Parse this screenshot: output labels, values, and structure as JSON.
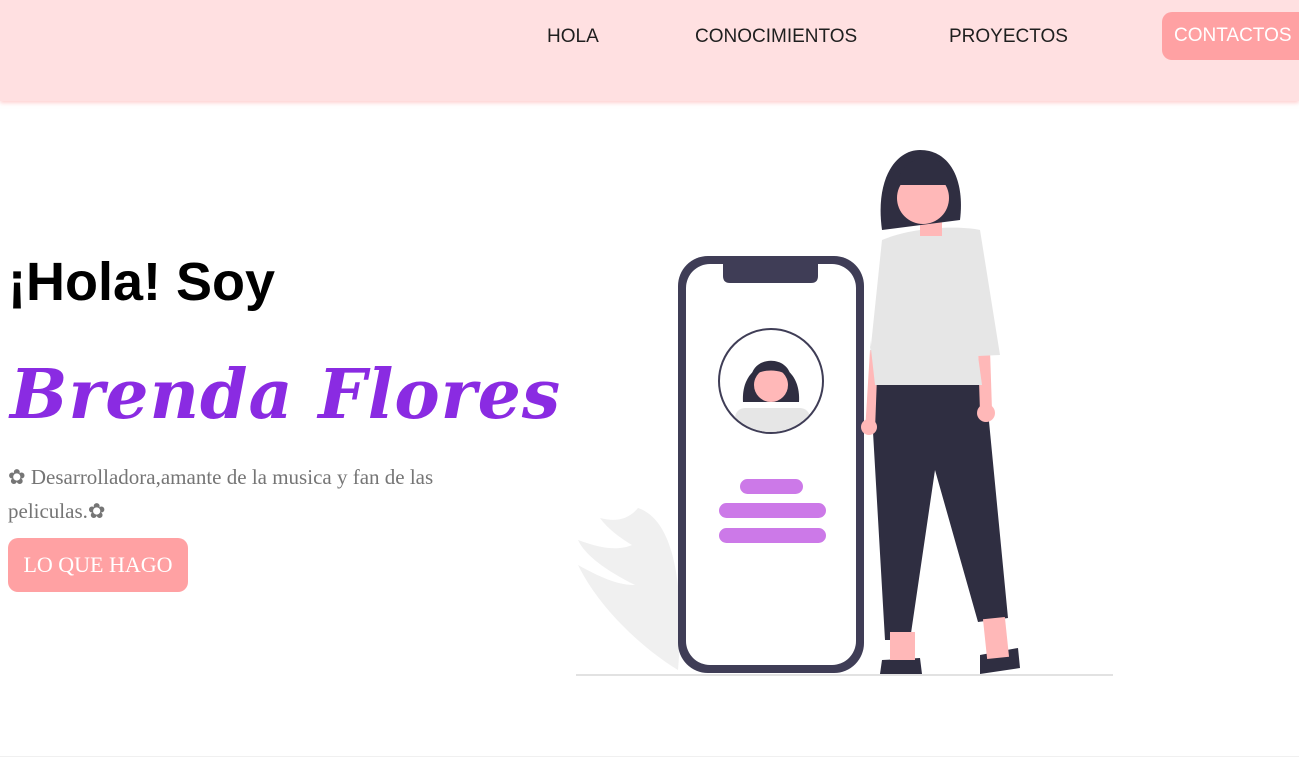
{
  "nav": {
    "items": [
      {
        "label": "HOLA"
      },
      {
        "label": "CONOCIMIENTOS"
      },
      {
        "label": "PROYECTOS"
      }
    ],
    "contact_label": "CONTACTOS"
  },
  "hero": {
    "greeting": "¡Hola! Soy",
    "name": "Brenda Flores",
    "description": "✿ Desarrolladora,amante de la musica y fan de las peliculas.✿",
    "cta_label": "LO QUE HAGO"
  },
  "colors": {
    "navbar_bg": "#ffe0e1",
    "accent_pink": "#ffa1a3",
    "name_purple": "#8a2be2",
    "illustration_dark": "#3f3d56",
    "illustration_purple": "#cc79e8"
  },
  "illustration": {
    "name": "woman-with-phone-illustration"
  }
}
